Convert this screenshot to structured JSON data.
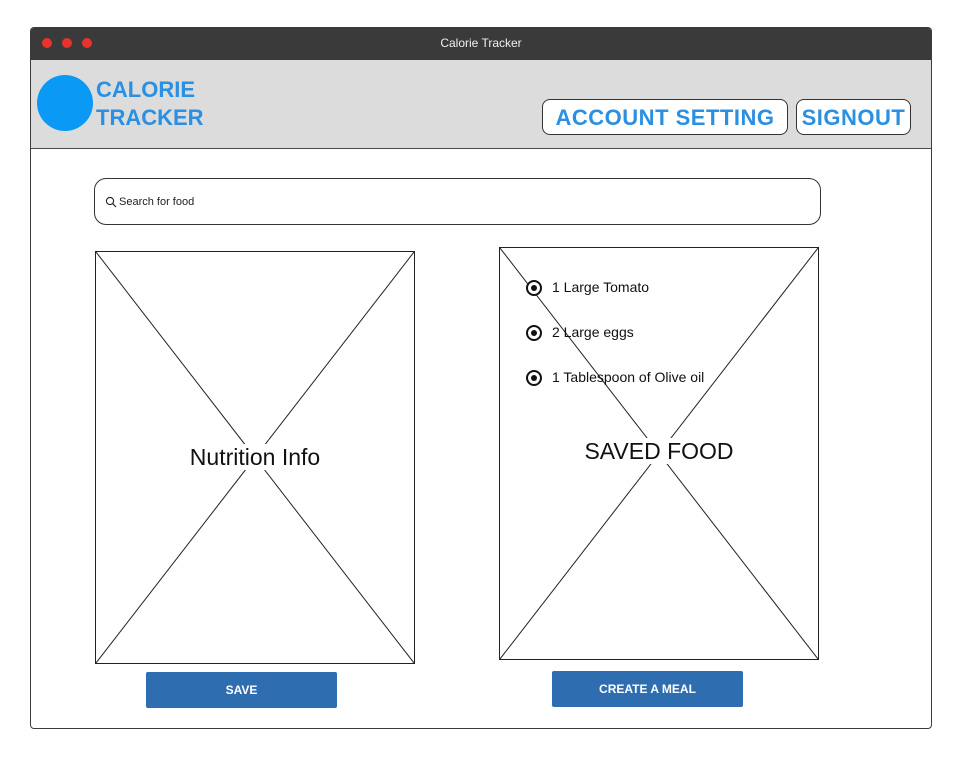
{
  "window": {
    "title": "Calorie Tracker"
  },
  "header": {
    "logo_line1": "CALORIE",
    "logo_line2": "TRACKER",
    "account_setting_label": "ACCOUNT SETTING",
    "signout_label": "SIGNOUT"
  },
  "search": {
    "placeholder": "Search for food",
    "value": ""
  },
  "nutrition": {
    "label": "Nutrition Info",
    "save_label": "SAVE"
  },
  "saved_food": {
    "label": "SAVED FOOD",
    "items": [
      {
        "label": "1 Large Tomato",
        "selected": true
      },
      {
        "label": "2 Large eggs",
        "selected": true
      },
      {
        "label": "1 Tablespoon of Olive oil",
        "selected": true
      }
    ],
    "create_meal_label": "CREATE A MEAL"
  },
  "colors": {
    "accent": "#2b8fe2",
    "logo": "#0a99f5",
    "button": "#2e6db0",
    "titlebar": "#3a3a3a",
    "header_bg": "#dcdcdc",
    "traffic_light": "#e8332a"
  },
  "icons": {
    "search": "search-icon",
    "window_controls": [
      "close-icon",
      "minimize-icon",
      "maximize-icon"
    ]
  }
}
